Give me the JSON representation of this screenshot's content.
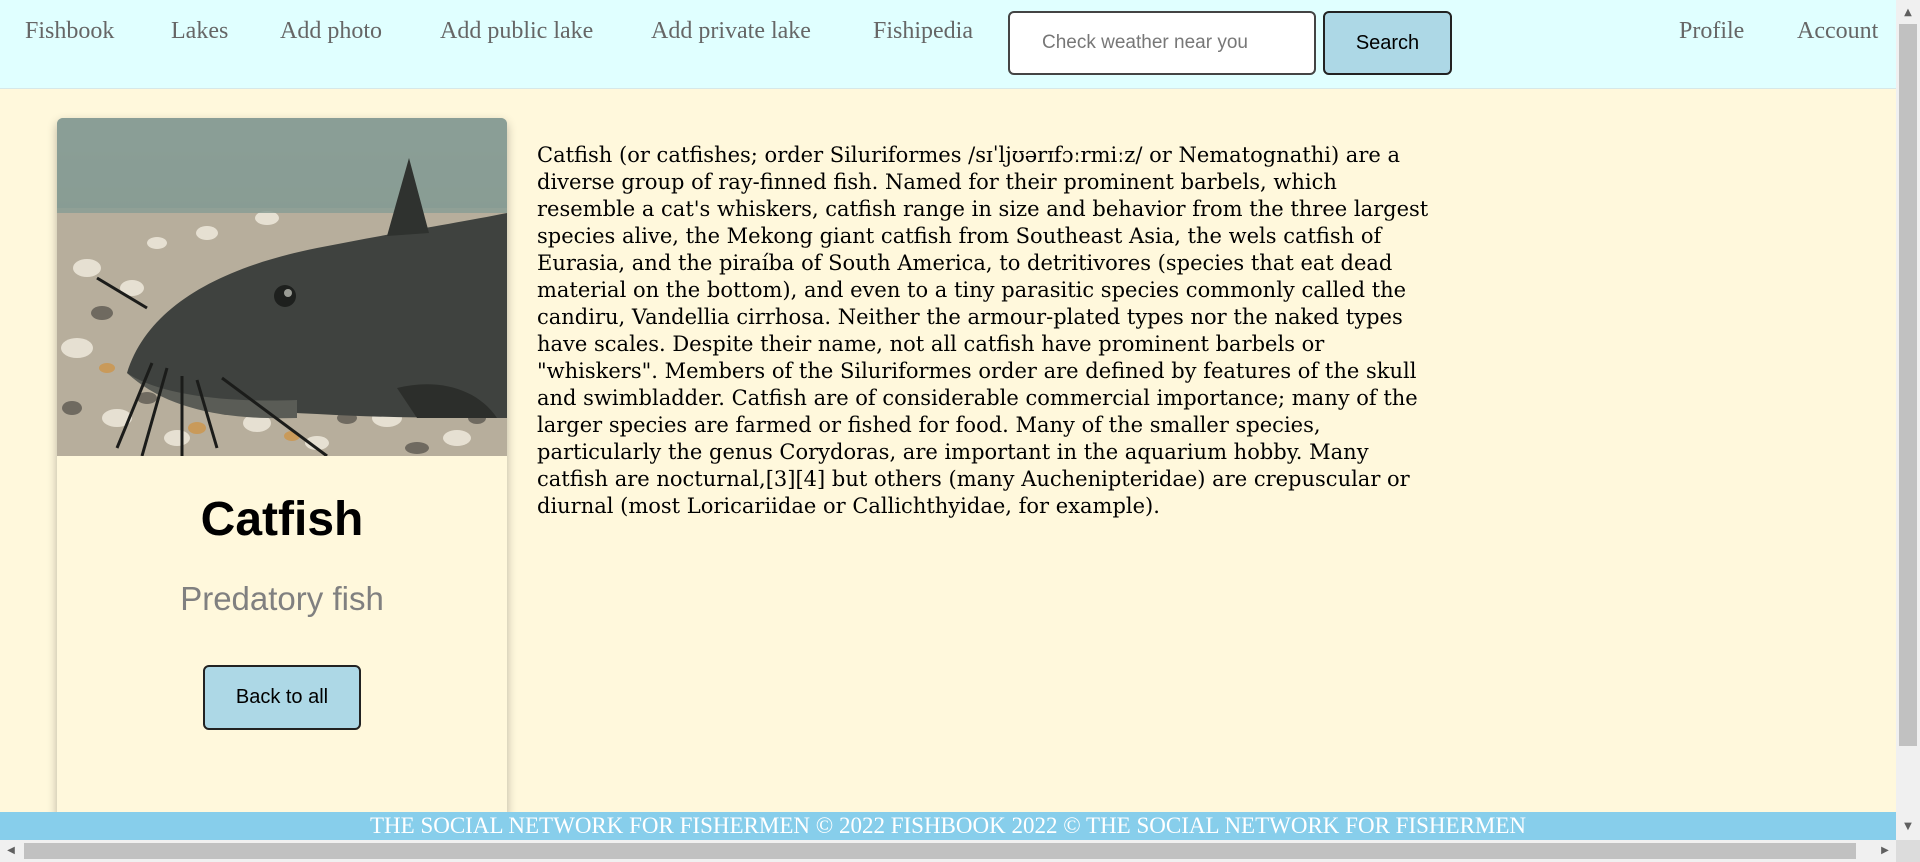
{
  "nav": {
    "brand": "Fishbook",
    "links": [
      "Lakes",
      "Add photo",
      "Add public lake",
      "Add private lake",
      "Fishipedia"
    ],
    "search_placeholder": "Check weather near you",
    "search_button": "Search",
    "right_links": [
      "Profile",
      "Account"
    ]
  },
  "fish": {
    "image_icon": "catfish-photo",
    "name": "Catfish",
    "category": "Predatory fish",
    "back_label": "Back to all",
    "description": "Catfish (or catfishes; order Siluriformes /sɪˈljʊərɪfɔːrmiːz/ or Nematognathi) are a diverse group of ray-finned fish. Named for their prominent barbels, which resemble a cat's whiskers, catfish range in size and behavior from the three largest species alive, the Mekong giant catfish from Southeast Asia, the wels catfish of Eurasia, and the piraíba of South America, to detritivores (species that eat dead material on the bottom), and even to a tiny parasitic species commonly called the candiru, Vandellia cirrhosa. Neither the armour-plated types nor the naked types have scales. Despite their name, not all catfish have prominent barbels or \"whiskers\". Members of the Siluriformes order are defined by features of the skull and swimbladder. Catfish are of considerable commercial importance; many of the larger species are farmed or fished for food. Many of the smaller species, particularly the genus Corydoras, are important in the aquarium hobby. Many catfish are nocturnal,[3][4] but others (many Auchenipteridae) are crepuscular or diurnal (most Loricariidae or Callichthyidae, for example)."
  },
  "footer": {
    "text": "THE SOCIAL NETWORK FOR FISHERMEN © 2022 FISHBOOK 2022 © THE SOCIAL NETWORK FOR FISHERMEN"
  },
  "colors": {
    "page_bg": "#fff8dc",
    "nav_bg": "#e0ffff",
    "button_bg": "#add8e6",
    "footer_bg": "#87ceeb"
  }
}
